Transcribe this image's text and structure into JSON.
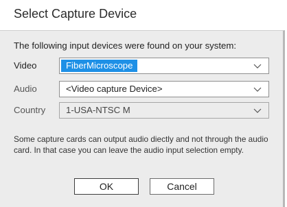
{
  "window": {
    "title": "Select Capture Device"
  },
  "intro_text": "The following input devices were found on your system:",
  "fields": {
    "video": {
      "label": "Video",
      "value": "FiberMicroscope",
      "selected": true
    },
    "audio": {
      "label": "Audio",
      "value": "<Video capture Device>"
    },
    "country": {
      "label": "Country",
      "value": "1-USA-NTSC M",
      "enabled": false
    }
  },
  "help_text": "Some capture cards can output audio diectly and not through the audio card. In that case you can leave the audio input selection empty.",
  "buttons": {
    "ok": "OK",
    "cancel": "Cancel"
  },
  "icons": {
    "dropdown": "chevron-down-icon"
  },
  "colors": {
    "selection": "#1e90e6",
    "dialog_background": "#ececec"
  }
}
